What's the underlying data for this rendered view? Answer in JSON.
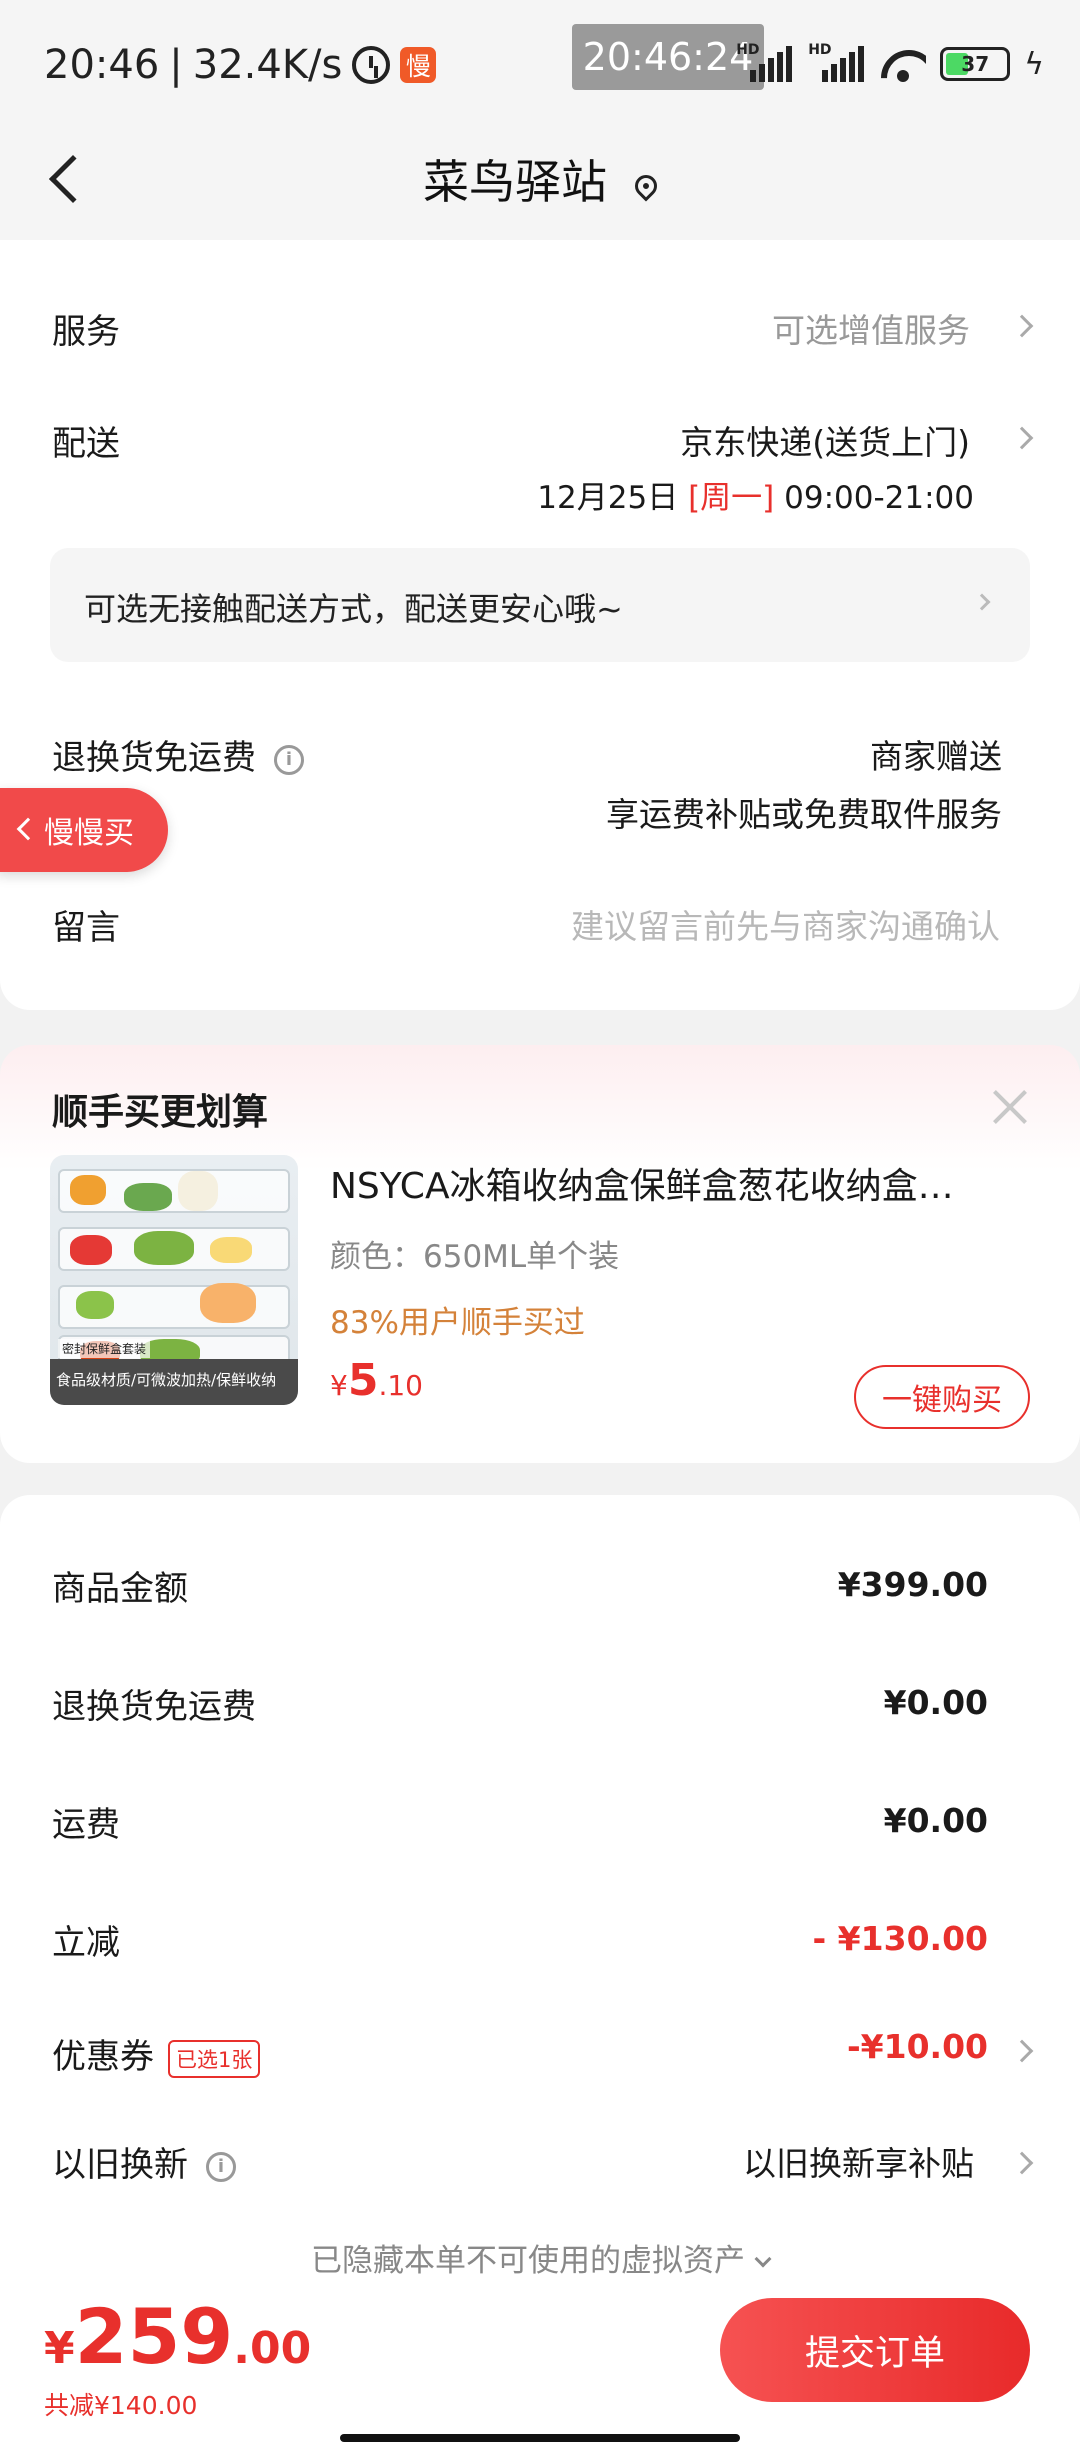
{
  "status_bar": {
    "time": "20:46",
    "net_speed": "32.4K/s",
    "app_badge": "慢",
    "overlay_time": "20:46:24",
    "signal_labels": [
      "HD",
      "HD"
    ],
    "battery": "37",
    "battery_level": 0.37
  },
  "header": {
    "title": "菜鸟驿站"
  },
  "service": {
    "label": "服务",
    "value": "可选增值服务"
  },
  "delivery": {
    "label": "配送",
    "carrier": "京东快递(送货上门)",
    "date": "12月25日",
    "weekday": "[周一]",
    "hours": "09:00-21:00"
  },
  "notice": {
    "text": "可选无接触配送方式，配送更安心哦~"
  },
  "return_shipping": {
    "label": "退换货免运费",
    "value": "商家赠送",
    "desc": "享运费补贴或免费取件服务"
  },
  "float_button": {
    "label": "慢慢买"
  },
  "message": {
    "label": "留言",
    "placeholder": "建议留言前先与商家沟通确认"
  },
  "upsell": {
    "title": "顺手买更划算",
    "product_name": "NSYCA冰箱收纳盒保鲜盒葱花收纳盒…",
    "spec": "颜色：650ML单个装",
    "stat": "83%用户顺手买过",
    "price_currency": "¥",
    "price_int": "5",
    "price_dec": ".10",
    "buy_label": "一键购买",
    "image_caption_top": "密封保鲜盒套装",
    "image_caption": "食品级材质/可微波加热/保鲜收纳"
  },
  "summary": {
    "goods_label": "商品金额",
    "goods_value": "¥399.00",
    "return_label": "退换货免运费",
    "return_value": "¥0.00",
    "freight_label": "运费",
    "freight_value": "¥0.00",
    "discount_label": "立减",
    "discount_value": "- ¥130.00",
    "coupon_label": "优惠券",
    "coupon_tag": "已选1张",
    "coupon_value": "-¥10.00",
    "tradein_label": "以旧换新",
    "tradein_value": "以旧换新享补贴"
  },
  "hidden_note": "已隐藏本单不可使用的虚拟资产",
  "bottom": {
    "currency": "¥",
    "total_int": "259",
    "total_dec": ".00",
    "saved": "共减¥140.00",
    "submit_label": "提交订单"
  },
  "colors": {
    "accent": "#e8302c",
    "orange_text": "#d4823a",
    "background": "#f2f2f2"
  }
}
